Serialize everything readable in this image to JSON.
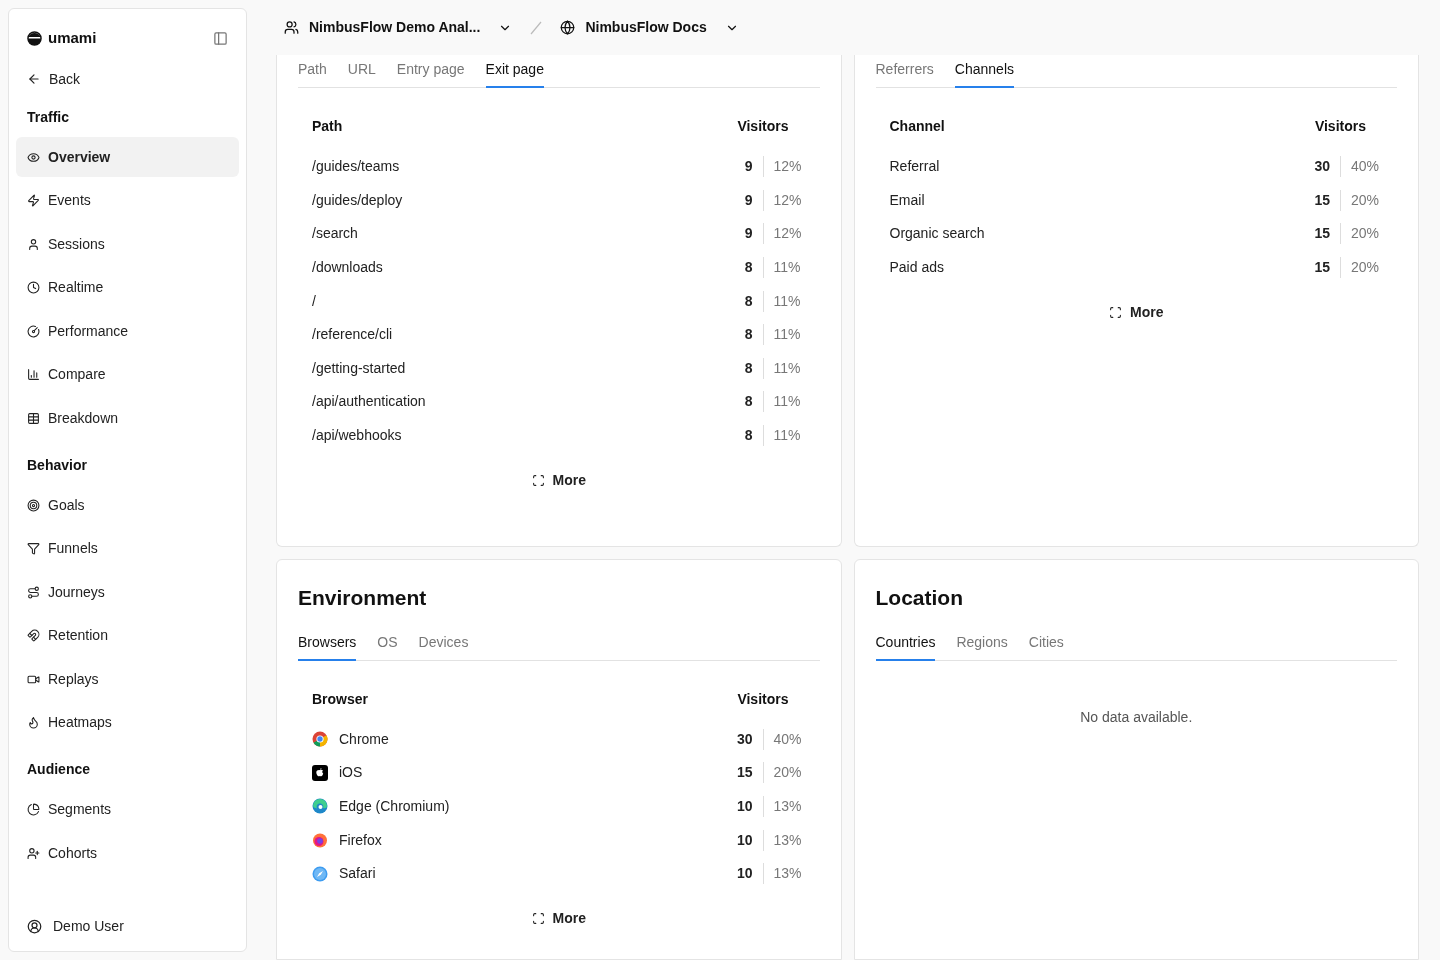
{
  "sidebar": {
    "brand": "umami",
    "back": "Back",
    "sections": [
      {
        "title": "Traffic",
        "items": [
          {
            "label": "Overview",
            "selected": true
          },
          {
            "label": "Events",
            "selected": false
          },
          {
            "label": "Sessions",
            "selected": false
          },
          {
            "label": "Realtime",
            "selected": false
          },
          {
            "label": "Performance",
            "selected": false
          },
          {
            "label": "Compare",
            "selected": false
          },
          {
            "label": "Breakdown",
            "selected": false
          }
        ]
      },
      {
        "title": "Behavior",
        "items": [
          {
            "label": "Goals",
            "selected": false
          },
          {
            "label": "Funnels",
            "selected": false
          },
          {
            "label": "Journeys",
            "selected": false
          },
          {
            "label": "Retention",
            "selected": false
          },
          {
            "label": "Replays",
            "selected": false
          },
          {
            "label": "Heatmaps",
            "selected": false
          }
        ]
      },
      {
        "title": "Audience",
        "items": [
          {
            "label": "Segments",
            "selected": false
          },
          {
            "label": "Cohorts",
            "selected": false
          }
        ]
      }
    ],
    "user": "Demo User"
  },
  "header": {
    "team": "NimbusFlow Demo Anal...",
    "website": "NimbusFlow Docs"
  },
  "panels": [
    {
      "tabs": [
        {
          "label": "Path",
          "selected": false
        },
        {
          "label": "URL",
          "selected": false
        },
        {
          "label": "Entry page",
          "selected": false
        },
        {
          "label": "Exit page",
          "selected": true
        }
      ],
      "columns": [
        "Path",
        "Visitors"
      ],
      "rows": [
        {
          "label": "/guides/teams",
          "visitors": "9",
          "percent": "12%"
        },
        {
          "label": "/guides/deploy",
          "visitors": "9",
          "percent": "12%"
        },
        {
          "label": "/search",
          "visitors": "9",
          "percent": "12%"
        },
        {
          "label": "/downloads",
          "visitors": "8",
          "percent": "11%"
        },
        {
          "label": "/",
          "visitors": "8",
          "percent": "11%"
        },
        {
          "label": "/reference/cli",
          "visitors": "8",
          "percent": "11%"
        },
        {
          "label": "/getting-started",
          "visitors": "8",
          "percent": "11%"
        },
        {
          "label": "/api/authentication",
          "visitors": "8",
          "percent": "11%"
        },
        {
          "label": "/api/webhooks",
          "visitors": "8",
          "percent": "11%"
        }
      ],
      "more": "More"
    },
    {
      "tabs": [
        {
          "label": "Referrers",
          "selected": false
        },
        {
          "label": "Channels",
          "selected": true
        }
      ],
      "columns": [
        "Channel",
        "Visitors"
      ],
      "rows": [
        {
          "label": "Referral",
          "visitors": "30",
          "percent": "40%"
        },
        {
          "label": "Email",
          "visitors": "15",
          "percent": "20%"
        },
        {
          "label": "Organic search",
          "visitors": "15",
          "percent": "20%"
        },
        {
          "label": "Paid ads",
          "visitors": "15",
          "percent": "20%"
        }
      ],
      "more": "More"
    },
    {
      "title": "Environment",
      "tabs": [
        {
          "label": "Browsers",
          "selected": true
        },
        {
          "label": "OS",
          "selected": false
        },
        {
          "label": "Devices",
          "selected": false
        }
      ],
      "columns": [
        "Browser",
        "Visitors"
      ],
      "rows": [
        {
          "kind": "chrome",
          "label": "Chrome",
          "visitors": "30",
          "percent": "40%"
        },
        {
          "kind": "ios",
          "label": "iOS",
          "visitors": "15",
          "percent": "20%"
        },
        {
          "kind": "edge",
          "label": "Edge (Chromium)",
          "visitors": "10",
          "percent": "13%"
        },
        {
          "kind": "firefox",
          "label": "Firefox",
          "visitors": "10",
          "percent": "13%"
        },
        {
          "kind": "safari",
          "label": "Safari",
          "visitors": "10",
          "percent": "13%"
        }
      ],
      "more": "More"
    },
    {
      "title": "Location",
      "tabs": [
        {
          "label": "Countries",
          "selected": true
        },
        {
          "label": "Regions",
          "selected": false
        },
        {
          "label": "Cities",
          "selected": false
        }
      ],
      "empty_message": "No data available."
    }
  ]
}
